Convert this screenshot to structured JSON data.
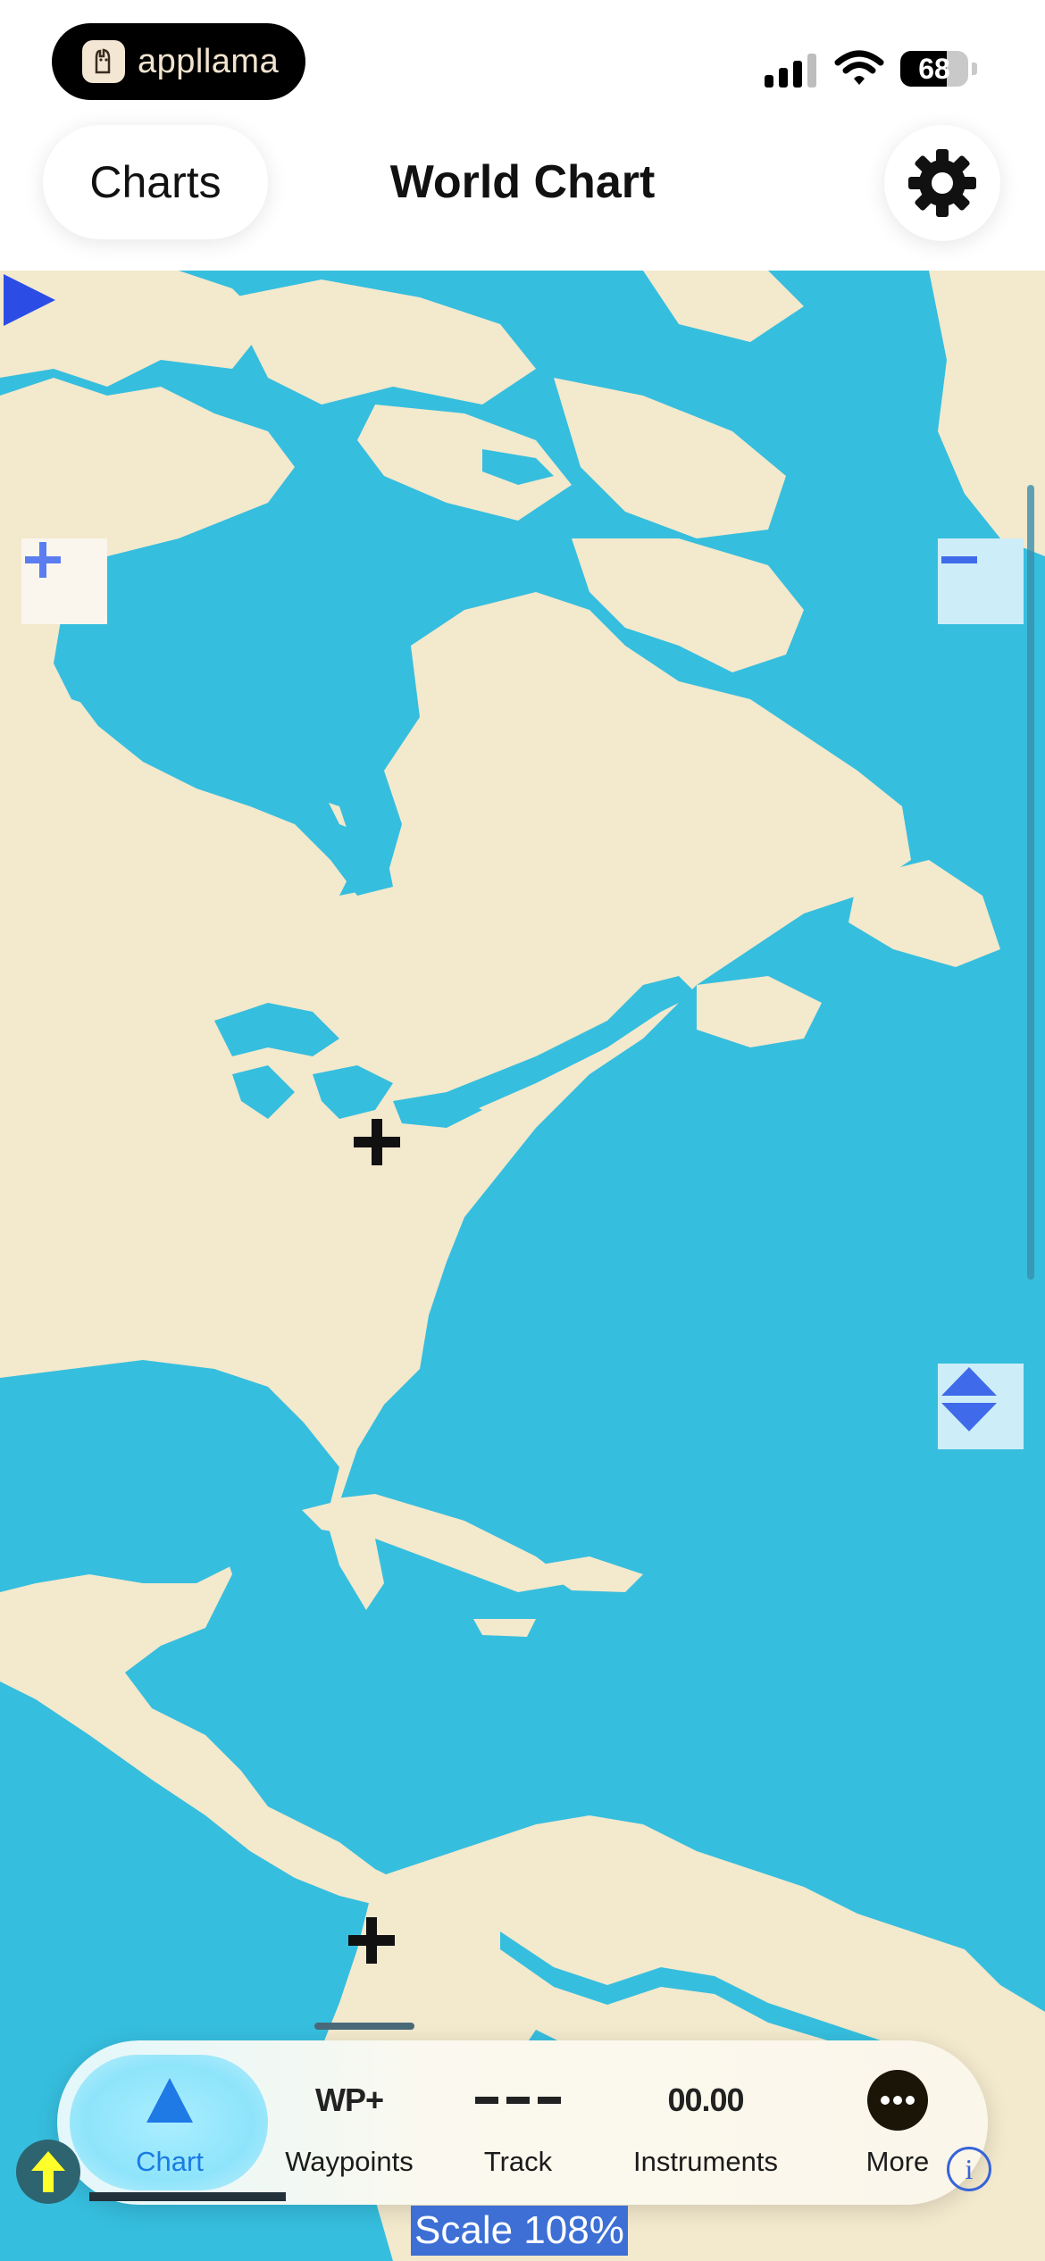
{
  "status_bar": {
    "app_badge": "appllama",
    "battery": "68",
    "battery_level": 0.68
  },
  "nav": {
    "back_label": "Charts",
    "title": "World Chart",
    "settings_icon": "gear-icon"
  },
  "map": {
    "water_color": "#36bede",
    "land_color": "#f3e9cd",
    "icons": {
      "zoom_in": "plus-icon",
      "zoom_out": "minus-icon",
      "vertical_size": "up-down-arrows-icon",
      "play": "play-icon",
      "crosshair": "crosshair-icon"
    }
  },
  "tabs": [
    {
      "label": "Chart",
      "icon": "triangle-icon",
      "active": true
    },
    {
      "label": "Waypoints",
      "glyph": "WP+",
      "icon": "waypoint-add-icon"
    },
    {
      "label": "Track",
      "icon": "dashed-line-icon"
    },
    {
      "label": "Instruments",
      "glyph": "00.00",
      "icon": "instruments-icon"
    },
    {
      "label": "More",
      "icon": "ellipsis-icon"
    }
  ],
  "footer": {
    "scale": "Scale 108%",
    "info_glyph": "i"
  }
}
